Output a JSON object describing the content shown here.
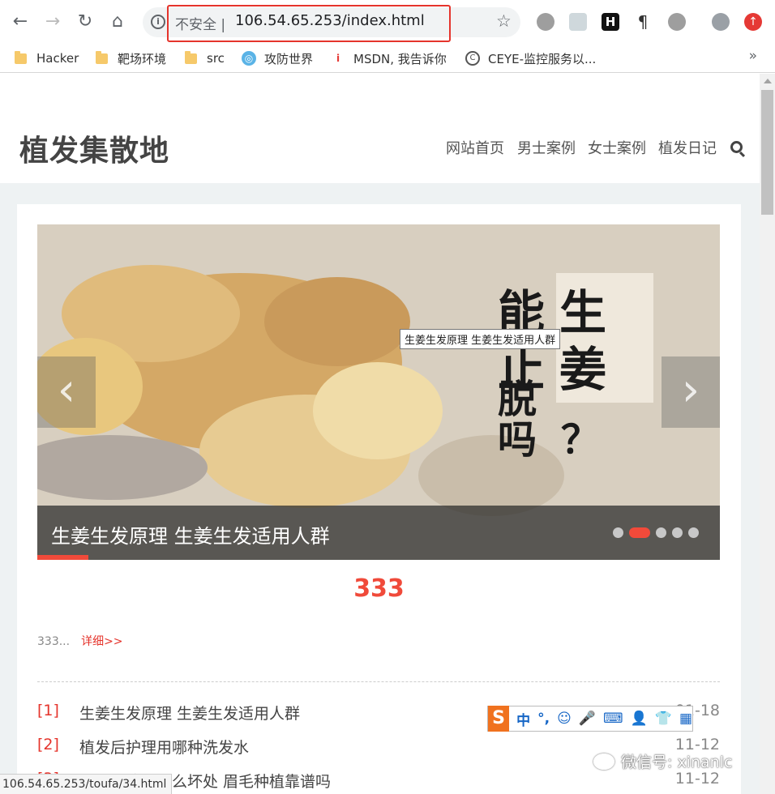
{
  "browser": {
    "security_label": "不安全",
    "url": "106.54.65.253/index.html",
    "bookmarks": [
      "Hacker",
      "靶场环境",
      "src",
      "攻防世界",
      "MSDN, 我告诉你",
      "CEYE-监控服务以..."
    ],
    "more_bookmarks": "»"
  },
  "site": {
    "logo": "植发集散地",
    "nav": [
      "网站首页",
      "男士案例",
      "女士案例",
      "植发日记"
    ]
  },
  "slider": {
    "caption": "生姜生发原理 生姜生发适用人群",
    "tooltip": "生姜生发原理 生姜生发适用人群",
    "image_text": [
      "能生",
      "止姜",
      "脱",
      "吗？"
    ],
    "dot_count": 5,
    "active_dot": 2
  },
  "featured": {
    "title": "333",
    "excerpt": "333...",
    "more_label": "详细>>"
  },
  "articles": [
    {
      "index": "[1]",
      "title": "生姜生发原理 生姜生发适用人群",
      "date": "01-18"
    },
    {
      "index": "[2]",
      "title": "植发后护理用哪种洗发水",
      "date": "11-12"
    },
    {
      "index": "[3]",
      "title": "眉毛种植有什么坏处 眉毛种植靠谱吗",
      "date": "11-12"
    }
  ],
  "status_bar": {
    "url": "106.54.65.253/toufa/34.html"
  },
  "ime": {
    "logo": "S",
    "mode": "中",
    "punct": "°,",
    "items": [
      "☺",
      "🎤",
      "⌨",
      "👤",
      "👕",
      "▦"
    ]
  },
  "watermark": "微信号: xinanlc",
  "colors": {
    "accent": "#f04a3a",
    "highlight_box": "#e5342c"
  }
}
